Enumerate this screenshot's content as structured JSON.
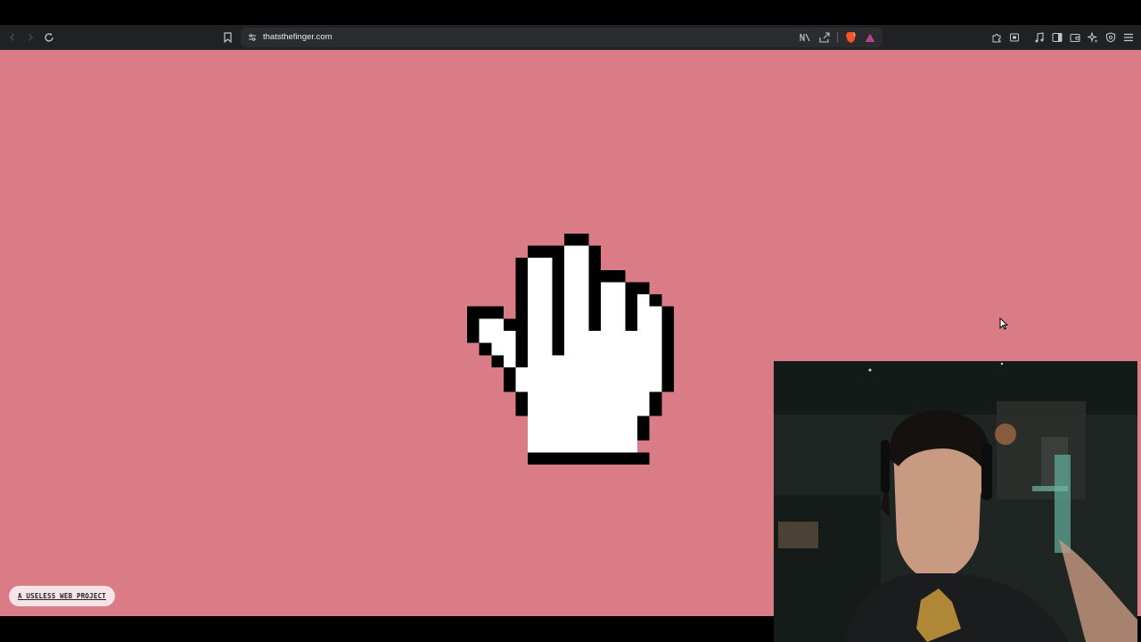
{
  "browser": {
    "url": "thatsthefinger.com",
    "icons": {
      "back": "back-arrow-icon",
      "forward": "forward-arrow-icon",
      "reload": "reload-icon",
      "bookmark": "bookmark-icon",
      "site_info": "site-info-icon",
      "reader": "reader-mode-icon",
      "share": "share-icon",
      "brave_shields": "brave-lion-icon",
      "brave_rewards": "brave-rewards-triangle-icon",
      "extensions": "extensions-icon",
      "screenshot": "screenshot-icon",
      "media": "music-note-icon",
      "sidebar": "sidebar-icon",
      "wallet": "wallet-icon",
      "leo": "leo-ai-icon",
      "vpn": "vpn-shield-icon",
      "menu": "hamburger-menu-icon"
    }
  },
  "page": {
    "background": "#d97c85",
    "footer_link": "A USELESS WEB PROJECT",
    "hero_icon": "pixel-hand-cursor-icon"
  },
  "overlay": {
    "webcam": "webcam-video-feed"
  }
}
